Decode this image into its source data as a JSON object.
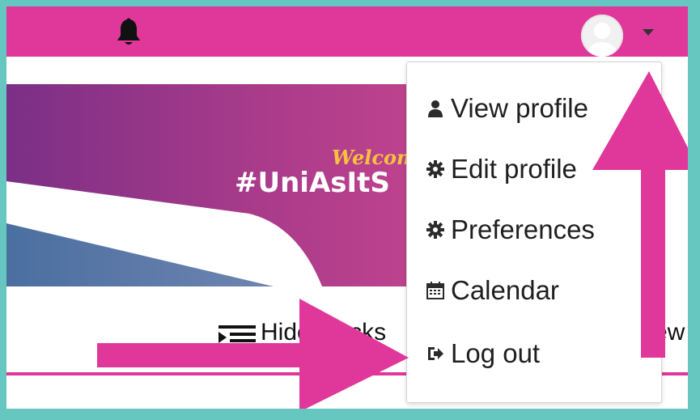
{
  "navbar": {
    "bell_icon": "bell-icon",
    "avatar_icon": "user-avatar",
    "caret_icon": "caret-down-icon",
    "accent_color": "#e0379a"
  },
  "banner": {
    "welcome_text": "Welcom",
    "hashtag_text": "#UniAsItS"
  },
  "toolbar": {
    "hide_blocks_label": "Hide blocks",
    "trailing_text": "ew"
  },
  "user_menu": {
    "items": [
      {
        "label": "View profile",
        "icon": "user-icon"
      },
      {
        "label": "Edit profile",
        "icon": "cog-icon"
      },
      {
        "label": "Preferences",
        "icon": "cog-icon"
      },
      {
        "label": "Calendar",
        "icon": "calendar-icon"
      },
      {
        "label": "Log out",
        "icon": "sign-out-icon"
      }
    ]
  },
  "annotations": {
    "arrow_color": "#e0379a",
    "background_color": "#66c6c0"
  }
}
